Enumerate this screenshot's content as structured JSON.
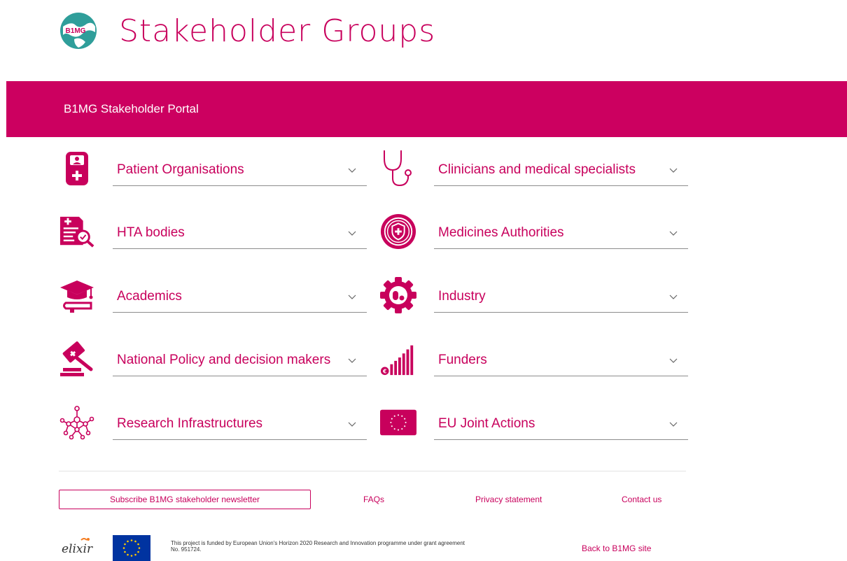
{
  "header": {
    "title": "Stakeholder Groups",
    "logo_text": "B1MG"
  },
  "banner": {
    "title": "B1MG Stakeholder Portal"
  },
  "groups": [
    {
      "label": "Patient Organisations",
      "icon": "patient-id-card-icon"
    },
    {
      "label": "Clinicians and medical specialists",
      "icon": "stethoscope-icon"
    },
    {
      "label": "HTA bodies",
      "icon": "document-magnifier-icon"
    },
    {
      "label": "Medicines Authorities",
      "icon": "shield-badge-icon"
    },
    {
      "label": "Academics",
      "icon": "graduation-cap-icon"
    },
    {
      "label": "Industry",
      "icon": "gear-pill-icon"
    },
    {
      "label": "National Policy and decision makers",
      "icon": "gavel-icon"
    },
    {
      "label": "Funders",
      "icon": "euro-bars-icon"
    },
    {
      "label": "Research Infrastructures",
      "icon": "network-nodes-icon"
    },
    {
      "label": "EU Joint Actions",
      "icon": "eu-flag-icon"
    }
  ],
  "footer": {
    "subscribe": "Subscribe B1MG stakeholder newsletter",
    "faqs": "FAQs",
    "privacy": "Privacy statement",
    "contact": "Contact us",
    "elixir": "elixir",
    "funding_text": "This project is funded by European Union's Horizon 2020 Research and Innovation programme under grant agreement No. 951724.",
    "back": "Back to B1MG site"
  },
  "colors": {
    "accent": "#c8005c",
    "banner": "#cc0060",
    "eu_blue": "#0033a0",
    "eu_gold": "#ffcc00"
  }
}
